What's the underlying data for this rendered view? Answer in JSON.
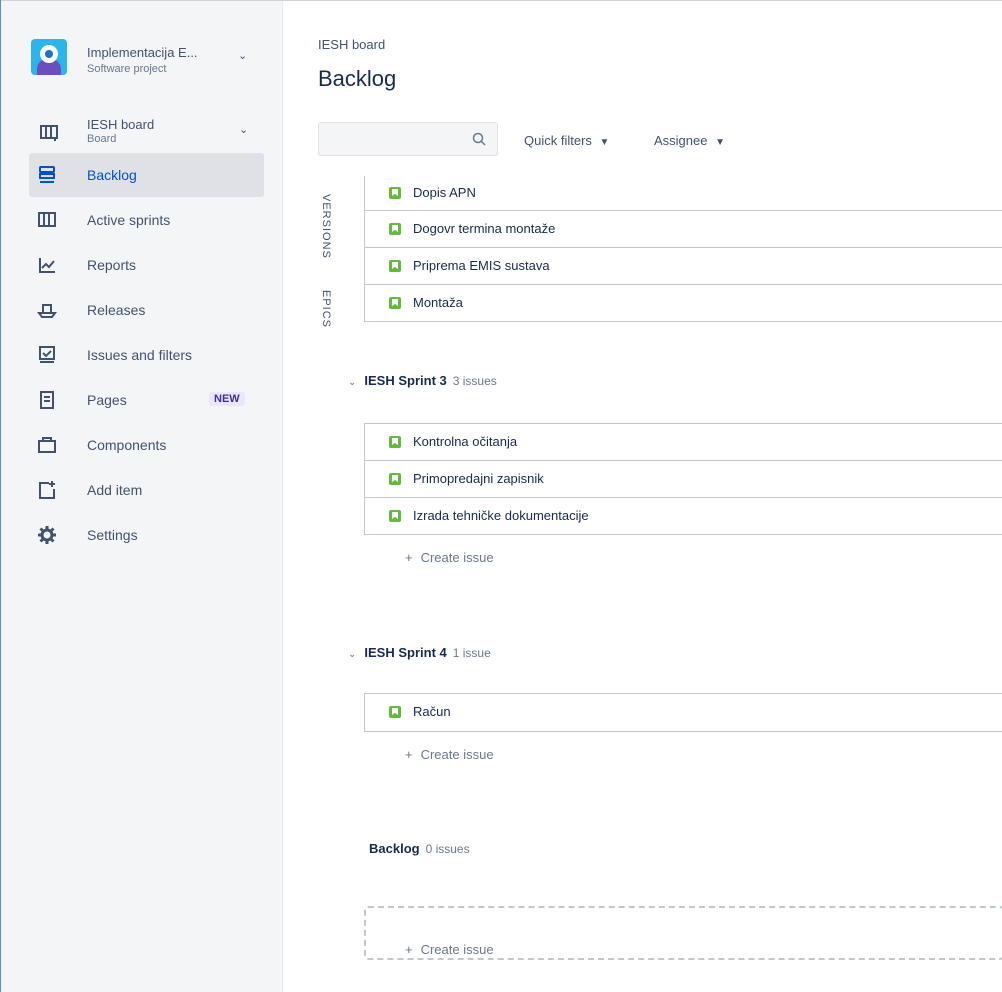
{
  "project": {
    "name": "Implementacija E...",
    "type": "Software project"
  },
  "board": {
    "title": "IESH board",
    "subtitle": "Board"
  },
  "nav": [
    {
      "label": "Backlog",
      "icon": "backlog-icon",
      "active": true
    },
    {
      "label": "Active sprints",
      "icon": "active-sprints-icon"
    },
    {
      "label": "Reports",
      "icon": "reports-icon"
    },
    {
      "label": "Releases",
      "icon": "releases-icon"
    },
    {
      "label": "Issues and filters",
      "icon": "issues-filters-icon"
    },
    {
      "label": "Pages",
      "icon": "pages-icon",
      "badge": "NEW"
    },
    {
      "label": "Components",
      "icon": "components-icon"
    },
    {
      "label": "Add item",
      "icon": "add-item-icon"
    },
    {
      "label": "Settings",
      "icon": "settings-icon"
    }
  ],
  "header": {
    "breadcrumb": "IESH board",
    "title": "Backlog"
  },
  "toolbar": {
    "search_placeholder": "",
    "quick_filters": "Quick filters",
    "assignee": "Assignee"
  },
  "side_tabs": {
    "versions": "VERSIONS",
    "epics": "EPICS"
  },
  "top_issues": [
    "Dopis APN",
    "Dogovr termina montaže",
    "Priprema EMIS sustava",
    "Montaža"
  ],
  "sprints": [
    {
      "name": "IESH Sprint 3",
      "count": "3 issues",
      "issues": [
        "Kontrolna očitanja",
        "Primopredajni zapisnik",
        "Izrada tehničke dokumentacije"
      ]
    },
    {
      "name": "IESH Sprint 4",
      "count": "1 issue",
      "issues": [
        "Račun"
      ]
    }
  ],
  "backlog": {
    "name": "Backlog",
    "count": "0 issues"
  },
  "create_issue": "Create issue",
  "colors": {
    "accent": "#0052cc",
    "story": "#63ba3c",
    "sidebar_bg": "#f4f5f7"
  }
}
